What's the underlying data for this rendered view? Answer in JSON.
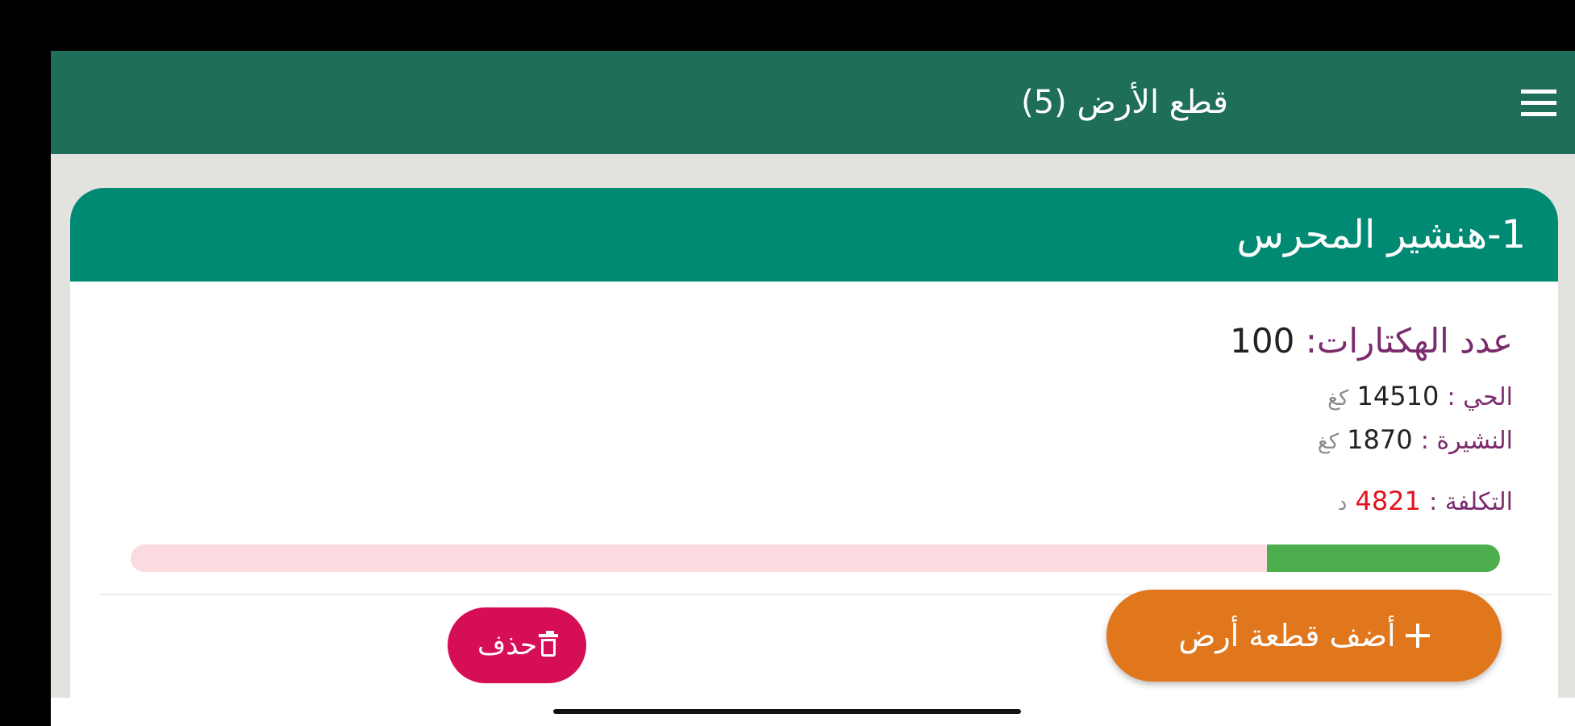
{
  "app_bar": {
    "title": "قطع الأرض (5)",
    "menu_icon": "hamburger-menu-icon"
  },
  "plot_card": {
    "title": "1-هنشير المحرس",
    "hectares_label": "عدد الهكتارات:",
    "hectares_value": "100",
    "alive_label": "الحي :",
    "alive_value": "14510",
    "alive_unit": "كغ",
    "sprouts_label": "النشيرة :",
    "sprouts_value": "1870",
    "sprouts_unit": "كغ",
    "cost_label": "التكلفة :",
    "cost_value": "4821",
    "cost_unit": "د",
    "progress_fraction": 0.17,
    "delete_label": "حذف",
    "delete_icon": "trash-icon"
  },
  "fab": {
    "label": "أضف قطعة أرض",
    "icon": "plus-icon"
  },
  "colors": {
    "app_bar": "#1f6e5a",
    "card_header": "#008a73",
    "label": "#7b2c6d",
    "cost": "#e0141e",
    "progress_fill": "#4cae4c",
    "progress_track": "#fbdbe0",
    "delete_button": "#d60e55",
    "add_button": "#e0771c"
  }
}
